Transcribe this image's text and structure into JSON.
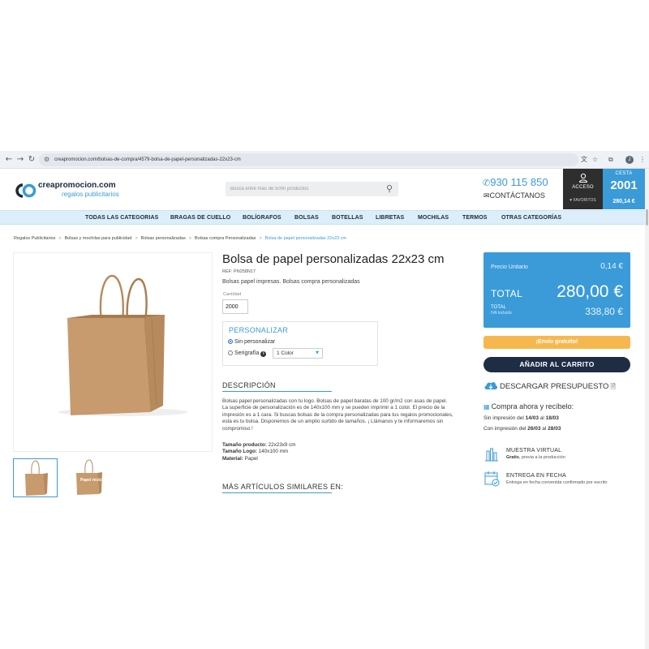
{
  "browser": {
    "url": "creapromocion.com/bolsas-de-compra/4579-bolsa-de-papel-personalizadas-22x23-cm",
    "profile_initial": "J"
  },
  "header": {
    "logo_mark": "CO",
    "logo_name": "creapromocion.com",
    "logo_tagline": "regalos publicitarios",
    "search_placeholder": "Busca entre más de 5000 productos",
    "phone": "930 115 850",
    "contact": "CONTÁCTANOS",
    "account_label": "ACCESO",
    "favorites_label": "♥ FAVORITOS",
    "cart_label": "CESTA",
    "cart_count": "2001",
    "cart_total": "280,14 €"
  },
  "nav": {
    "items": [
      "TODAS LAS CATEGORIAS",
      "BRAGAS DE CUELLO",
      "BOLÍGRAFOS",
      "BOLSAS",
      "BOTELLAS",
      "LIBRETAS",
      "MOCHILAS",
      "TERMOS",
      "OTRAS CATEGORÍAS"
    ]
  },
  "breadcrumb": {
    "items": [
      "Regalos Publicitarios",
      "Bolsas y mochilas para publicidad",
      "Bolsas personalizadas",
      "Bolsas compra Personalizadas"
    ],
    "current": "Bolsa de papel personalizadas 22x23 cm"
  },
  "gallery": {
    "thumb2_text": "Papel reciclado"
  },
  "product": {
    "title": "Bolsa de papel personalizadas 22x23 cm",
    "ref": "REF: PN258N17",
    "subtitle": "Bolsas papel impresas. Bolsas compra personalizadas",
    "quantity_label": "Cantidad",
    "quantity": "2000",
    "customize": {
      "title": "PERSONALIZAR",
      "option1": "Sin personalizar",
      "option2": "Serigrafía",
      "info_icon": "i",
      "color_value": "1 Color"
    },
    "description_title": "DESCRIPCIÓN",
    "description": "Bolsas papel personalizadas con tu logo. Bolsas de papel baratas de 100 gr/m2 con asas de papel. La superficie de personalización es de 140x100 mm y se pueden imprimir a 1 color. El precio de la impresión es a 1 cara. Si buscas bolsas de la compra personalizadas para tus regalos promocionales, esta es tu bolsa. Disponemos de un amplio surtido de tamaños. ¡ Llámanos y te informaremos sin compromiso !",
    "specs": [
      {
        "label": "Tamaño producto:",
        "value": "22x23x9 cm"
      },
      {
        "label": "Tamaño Logo:",
        "value": "140x100 mm"
      },
      {
        "label": "Material:",
        "value": "Papel"
      }
    ],
    "similar_title": "MÁS ARTÍCULOS SIMILARES EN:"
  },
  "pricing": {
    "unit_label": "Precio Unitario",
    "unit_price": "0,14 €",
    "total_label": "TOTAL",
    "total_price": "280,00 €",
    "total_iva_label": "TOTAL",
    "iva_note": "IVA incluido",
    "total_iva_price": "338,80 €",
    "shipping_badge": "¡Envío gratuito!",
    "add_to_cart": "AÑADIR AL CARRITO",
    "quote": "DESCARGAR PRESUPUESTO",
    "buy_now": "Compra ahora y recíbelo:",
    "ship_plain": {
      "prefix": "Sin impresión del",
      "from": "14/03",
      "mid": "al",
      "to": "18/03"
    },
    "ship_print": {
      "prefix": "Con impresión del",
      "from": "26/03",
      "mid": "al",
      "to": "28/03"
    }
  },
  "features": [
    {
      "title": "MUESTRA VIRTUAL",
      "bold": "Gratis",
      "sub": ", previa a la producción"
    },
    {
      "title": "ENTREGA EN FECHA",
      "bold": "",
      "sub": "Entrega en fecha convenida confirmado por escrito"
    }
  ],
  "colors": {
    "accent": "#3a9bd8",
    "nav_bg": "#dbeefa",
    "dark_button": "#1f2d44",
    "shipping": "#f6b84e",
    "account_bg": "#2e2e2e"
  }
}
